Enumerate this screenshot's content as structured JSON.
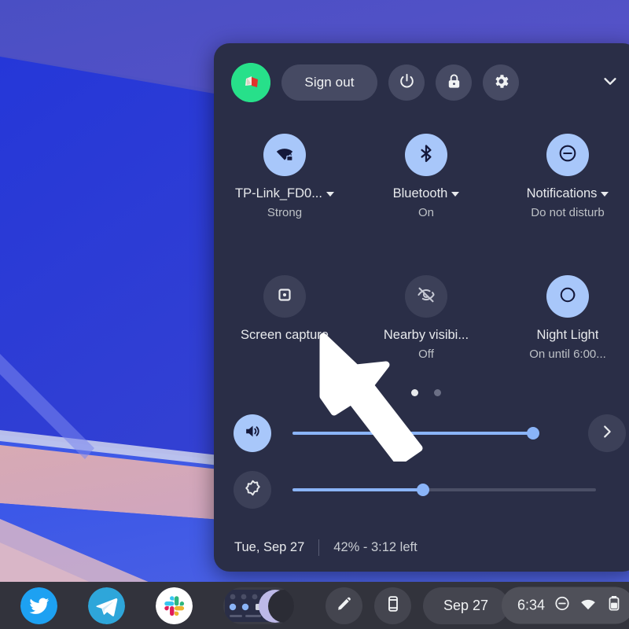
{
  "header": {
    "avatar_name": "user-avatar",
    "sign_out_label": "Sign out",
    "power_icon": "power-icon",
    "lock_icon": "lock-icon",
    "settings_icon": "gear-icon",
    "collapse_icon": "chevron-down-icon"
  },
  "tiles": {
    "page_dots": {
      "count": 2,
      "active_index": 0
    },
    "row1": [
      {
        "icon": "wifi-locked-icon",
        "label": "TP-Link_FD0...",
        "sublabel": "Strong",
        "state": "on",
        "has_caret": true
      },
      {
        "icon": "bluetooth-icon",
        "label": "Bluetooth",
        "sublabel": "On",
        "state": "on",
        "has_caret": true
      },
      {
        "icon": "do-not-disturb-icon",
        "label": "Notifications",
        "sublabel": "Do not disturb",
        "state": "on",
        "has_caret": true
      }
    ],
    "row2": [
      {
        "icon": "screen-capture-icon",
        "label": "Screen capture",
        "sublabel": "",
        "state": "off",
        "has_caret": false
      },
      {
        "icon": "nearby-visibility-off-icon",
        "label": "Nearby visibi...",
        "sublabel": "Off",
        "state": "off",
        "has_caret": false
      },
      {
        "icon": "night-light-moon-icon",
        "label": "Night Light",
        "sublabel": "On until 6:00...",
        "state": "on",
        "has_caret": false
      }
    ]
  },
  "sliders": {
    "volume": {
      "icon": "volume-up-icon",
      "value": 100,
      "state": "on",
      "next_icon": "chevron-right-icon"
    },
    "brightness": {
      "icon": "brightness-icon",
      "value": 43,
      "state": "off"
    }
  },
  "footer": {
    "date": "Tue, Sep 27",
    "battery": "42% - 3:12 left"
  },
  "shelf": {
    "apps": [
      {
        "name": "twitter-app-icon",
        "label": "Twitter"
      },
      {
        "name": "telegram-app-icon",
        "label": "Telegram"
      },
      {
        "name": "slack-app-icon",
        "label": "Slack"
      },
      {
        "name": "quick-settings-window-thumbnail",
        "label": "Quick Settings"
      }
    ],
    "buttons": [
      {
        "name": "stylus-pen-icon",
        "label": "Stylus tools"
      },
      {
        "name": "phone-hub-icon",
        "label": "Phone Hub"
      }
    ],
    "date_pill": "Sep 27",
    "status": {
      "clock": "6:34",
      "icons": [
        "do-not-disturb-icon",
        "wifi-icon",
        "battery-icon"
      ]
    }
  },
  "colors": {
    "panel_bg": "#2a2e47",
    "accent_blue": "#8ab4f8",
    "tile_on": "#a8c7fa",
    "tile_off": "#3c4058",
    "shelf_bg": "#32333c",
    "avatar_green": "#27e08a"
  }
}
